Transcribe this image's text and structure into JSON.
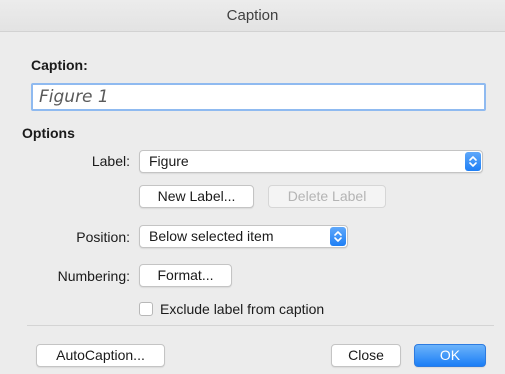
{
  "window": {
    "title": "Caption"
  },
  "caption": {
    "section_label": "Caption:",
    "value": "Figure 1"
  },
  "options": {
    "section_label": "Options",
    "label_row": {
      "label": "Label:",
      "selected": "Figure"
    },
    "new_label_button": "New Label...",
    "delete_label_button": "Delete Label",
    "position_row": {
      "label": "Position:",
      "selected": "Below selected item"
    },
    "numbering_row": {
      "label": "Numbering:",
      "format_button": "Format..."
    },
    "exclude_checkbox": {
      "label": "Exclude label from caption",
      "checked": false
    }
  },
  "footer": {
    "autocaption_button": "AutoCaption...",
    "close_button": "Close",
    "ok_button": "OK"
  },
  "colors": {
    "accent": "#1b7ef6",
    "focus_ring": "#8fbaf0",
    "background": "#ececec"
  },
  "icons": {
    "popup_stepper": "chevron-up-down-icon"
  }
}
